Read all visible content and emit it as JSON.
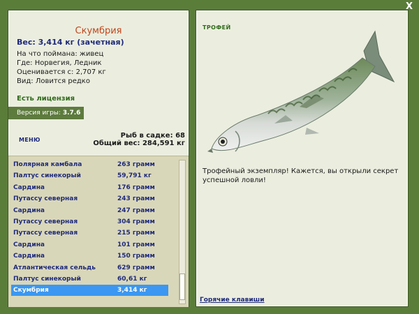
{
  "window": {
    "close_label": "X"
  },
  "catch": {
    "name": "Скумбрия",
    "weight_line": "Вес: 3,414 кг (зачетная)",
    "bait": "На что поймана: живец",
    "location": "Где: Норвегия, Ледник",
    "value": "Оценивается с: 2,707 кг",
    "species_type": "Вид: Ловится редко"
  },
  "license_text": "Есть лицензия",
  "version": {
    "label": "Версия игры:",
    "value": "3.7.6"
  },
  "menu_label": "МЕНЮ",
  "stats": {
    "fish_in_keepnet": "Рыб в садке: 68",
    "total_weight": "Общий вес: 284,591 кг"
  },
  "catch_list": [
    {
      "name": "Полярная камбала",
      "weight": "263 грамм"
    },
    {
      "name": "Палтус синекорый",
      "weight": "59,791 кг"
    },
    {
      "name": "Сардина",
      "weight": "176 грамм"
    },
    {
      "name": "Путассу северная",
      "weight": "243 грамм"
    },
    {
      "name": "Сардина",
      "weight": "247 грамм"
    },
    {
      "name": "Путассу северная",
      "weight": "304 грамм"
    },
    {
      "name": "Путассу северная",
      "weight": "215 грамм"
    },
    {
      "name": "Сардина",
      "weight": "101 грамм"
    },
    {
      "name": "Сардина",
      "weight": "150 грамм"
    },
    {
      "name": "Атлантическая сельдь",
      "weight": "629 грамм"
    },
    {
      "name": "Палтус синекорый",
      "weight": "60,61 кг"
    },
    {
      "name": "Скумбрия",
      "weight": "3,414 кг"
    }
  ],
  "selected_index": 11,
  "trophy": {
    "label": "ТРОФЕЙ",
    "text": "Трофейный экземпляр! Кажется, вы открыли секрет успешной ловли!",
    "image": "mackerel-fish"
  },
  "hotkeys_label": "Горячие клавиши",
  "colors": {
    "background": "#5a7d3a",
    "panel": "#ebeedf",
    "selection": "#3b97f1",
    "title": "#c0461c",
    "link": "#1e2a7a"
  }
}
